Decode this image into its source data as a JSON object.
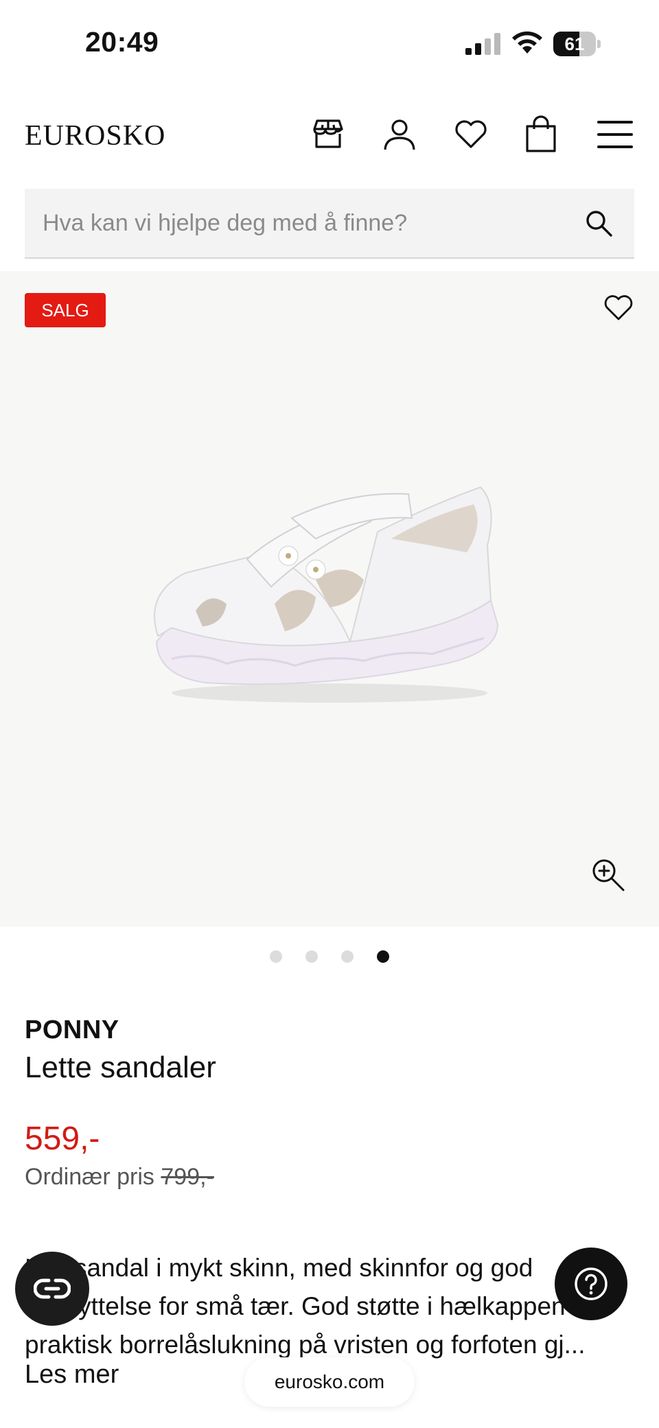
{
  "status_bar": {
    "time": "20:49",
    "battery_percent": "61",
    "battery_level": 0.61
  },
  "header": {
    "logo": "EUROSKO",
    "icons": [
      "store-icon",
      "account-icon",
      "wishlist-icon",
      "cart-icon",
      "menu-icon"
    ]
  },
  "search": {
    "placeholder": "Hva kan vi hjelpe deg med å finne?",
    "value": ""
  },
  "product_media": {
    "badge": "SALG",
    "image_count": 4,
    "active_image": 4
  },
  "product": {
    "brand": "PONNY",
    "title": "Lette sandaler",
    "price": "559,-",
    "ordinary_label": "Ordinær pris",
    "ordinary_price": "799,-",
    "description": "Lett sandal i mykt skinn, med skinnfor og god beskyttelse for små tær. God støtte i hælkappen og praktisk borrelåslukning på vristen og forfoten gj...",
    "read_more": "Les mer"
  },
  "browser": {
    "url": "eurosko.com"
  },
  "colors": {
    "sale_red": "#e31b13",
    "price_red": "#d21a14",
    "media_bg": "#f7f7f5"
  }
}
